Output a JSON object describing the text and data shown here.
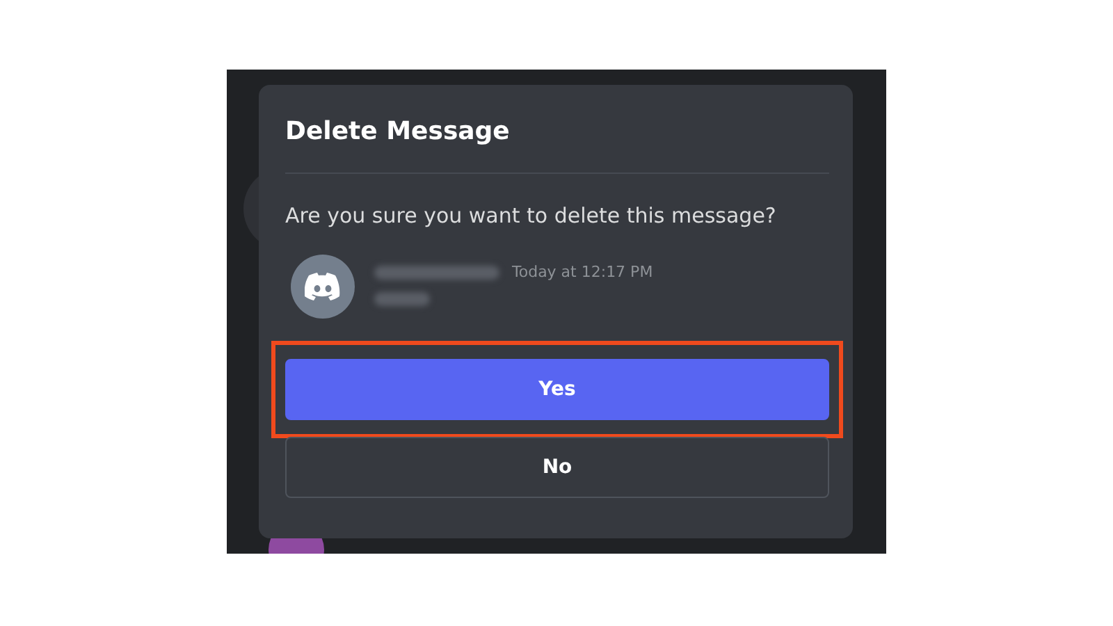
{
  "dialog": {
    "title": "Delete Message",
    "question": "Are you sure you want to delete this message?",
    "message": {
      "timestamp": "Today at 12:17 PM",
      "author_redacted": true
    },
    "buttons": [
      {
        "label": "Yes",
        "kind": "primary",
        "highlighted": true
      },
      {
        "label": "No",
        "kind": "outline",
        "highlighted": false
      }
    ]
  }
}
